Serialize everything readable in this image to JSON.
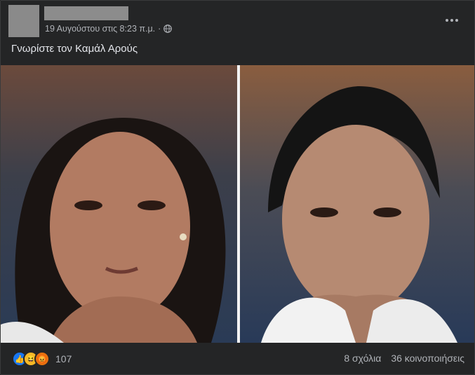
{
  "post": {
    "timestamp": "19 Αυγούστου στις 8:23 π.μ.",
    "separator": "·",
    "audience_icon": "globe-icon",
    "caption": "Γνωρίστε τον Καμάλ Αρούς",
    "reaction_count": "107",
    "comments": "8 σχόλια",
    "shares": "36 κοινοποιήσεις",
    "reaction_icons": [
      "like-icon",
      "haha-icon",
      "angry-icon"
    ]
  },
  "colors": {
    "background": "#242526",
    "text": "#e4e6eb",
    "secondary_text": "#b0b3b8",
    "like_blue": "#1877f2"
  }
}
